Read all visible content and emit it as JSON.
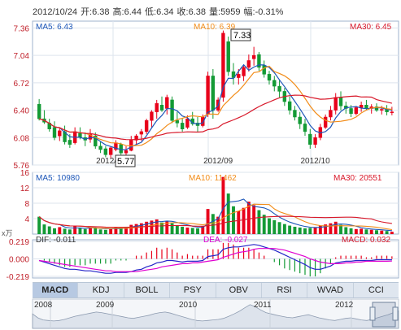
{
  "header": {
    "date": "2012/10/24",
    "open_label": "开:",
    "open": "6.38",
    "high_label": "高:",
    "high": "6.44",
    "low_label": "低:",
    "low": "6.34",
    "close_label": "收:",
    "close": "6.38",
    "volume_label": "量:",
    "volume": "5959",
    "change_label": "幅:",
    "change": "-0.31%"
  },
  "colors": {
    "up": "#e8001a",
    "down": "#139a35",
    "ma5": "#1d57b8",
    "ma10": "#f28c18",
    "ma30": "#d8182a",
    "grid": "#dde4ee",
    "axis_text": "#c0202a",
    "dea": "#e000d0",
    "dif": "#2424c8"
  },
  "chart_data": [
    {
      "type": "candlestick",
      "title": "",
      "legend": {
        "ma5": "MA5: 6.43",
        "ma10": "MA10: 6.39",
        "ma30": "MA30: 6.45"
      },
      "y_ticks": [
        "7.36",
        "7.04",
        "6.72",
        "6.40",
        "6.08",
        "5.76"
      ],
      "ylim": [
        5.76,
        7.44
      ],
      "x_labels": [
        "2012/08",
        "2012/09",
        "2012/10"
      ],
      "annotations": {
        "max": "7.33",
        "min": "5.77"
      },
      "ohlc": [
        [
          6.47,
          6.53,
          6.28,
          6.3
        ],
        [
          6.3,
          6.4,
          6.24,
          6.26
        ],
        [
          6.25,
          6.3,
          6.15,
          6.18
        ],
        [
          6.2,
          6.27,
          6.05,
          6.08
        ],
        [
          6.1,
          6.2,
          6.04,
          6.16
        ],
        [
          6.15,
          6.22,
          6.0,
          6.03
        ],
        [
          6.05,
          6.12,
          5.96,
          6.0
        ],
        [
          6.02,
          6.2,
          6.0,
          6.15
        ],
        [
          6.13,
          6.2,
          6.06,
          6.08
        ],
        [
          6.08,
          6.14,
          5.98,
          6.05
        ],
        [
          6.06,
          6.18,
          6.02,
          6.12
        ],
        [
          6.1,
          6.14,
          5.95,
          5.98
        ],
        [
          5.98,
          6.03,
          5.9,
          5.94
        ],
        [
          5.95,
          5.98,
          5.85,
          5.88
        ],
        [
          5.88,
          5.98,
          5.84,
          5.96
        ],
        [
          5.94,
          6.05,
          5.92,
          6.02
        ],
        [
          6.0,
          6.02,
          5.88,
          5.9
        ],
        [
          5.9,
          5.98,
          5.77,
          5.93
        ],
        [
          5.93,
          6.1,
          5.92,
          6.05
        ],
        [
          6.05,
          6.12,
          6.0,
          6.1
        ],
        [
          6.12,
          6.18,
          6.04,
          6.15
        ],
        [
          6.15,
          6.3,
          6.12,
          6.28
        ],
        [
          6.28,
          6.4,
          6.2,
          6.38
        ],
        [
          6.38,
          6.52,
          6.3,
          6.48
        ],
        [
          6.46,
          6.56,
          6.38,
          6.4
        ],
        [
          6.42,
          6.58,
          6.35,
          6.55
        ],
        [
          6.52,
          6.56,
          6.25,
          6.28
        ],
        [
          6.28,
          6.38,
          6.2,
          6.25
        ],
        [
          6.25,
          6.3,
          6.15,
          6.18
        ],
        [
          6.2,
          6.34,
          6.18,
          6.3
        ],
        [
          6.3,
          6.38,
          6.22,
          6.24
        ],
        [
          6.25,
          6.32,
          6.14,
          6.22
        ],
        [
          6.22,
          6.35,
          6.2,
          6.32
        ],
        [
          6.35,
          6.85,
          6.32,
          6.8
        ],
        [
          6.8,
          6.88,
          6.3,
          6.4
        ],
        [
          6.4,
          6.55,
          6.38,
          6.52
        ],
        [
          6.55,
          7.33,
          6.5,
          7.3
        ],
        [
          7.2,
          7.26,
          6.8,
          6.85
        ],
        [
          6.85,
          6.95,
          6.7,
          6.78
        ],
        [
          6.78,
          6.88,
          6.7,
          6.82
        ],
        [
          6.8,
          6.92,
          6.74,
          6.9
        ],
        [
          6.9,
          7.05,
          6.85,
          6.98
        ],
        [
          7.0,
          7.14,
          6.92,
          7.04
        ],
        [
          7.05,
          7.08,
          6.86,
          6.9
        ],
        [
          6.92,
          6.98,
          6.78,
          6.82
        ],
        [
          6.82,
          6.86,
          6.7,
          6.75
        ],
        [
          6.75,
          6.8,
          6.62,
          6.68
        ],
        [
          6.68,
          6.75,
          6.55,
          6.62
        ],
        [
          6.62,
          6.66,
          6.45,
          6.5
        ],
        [
          6.5,
          6.56,
          6.35,
          6.4
        ],
        [
          6.4,
          6.45,
          6.28,
          6.32
        ],
        [
          6.32,
          6.38,
          6.18,
          6.24
        ],
        [
          6.24,
          6.3,
          6.1,
          6.15
        ],
        [
          6.12,
          6.18,
          5.95,
          6.0
        ],
        [
          6.0,
          6.12,
          5.96,
          6.08
        ],
        [
          6.08,
          6.24,
          6.05,
          6.2
        ],
        [
          6.2,
          6.35,
          6.18,
          6.32
        ],
        [
          6.32,
          6.45,
          6.28,
          6.4
        ],
        [
          6.4,
          6.6,
          6.35,
          6.55
        ],
        [
          6.55,
          6.62,
          6.4,
          6.45
        ],
        [
          6.45,
          6.5,
          6.36,
          6.42
        ],
        [
          6.42,
          6.46,
          6.32,
          6.36
        ],
        [
          6.36,
          6.45,
          6.34,
          6.43
        ],
        [
          6.43,
          6.5,
          6.38,
          6.46
        ],
        [
          6.46,
          6.52,
          6.4,
          6.42
        ],
        [
          6.42,
          6.47,
          6.36,
          6.44
        ],
        [
          6.44,
          6.48,
          6.38,
          6.4
        ],
        [
          6.4,
          6.45,
          6.35,
          6.41
        ],
        [
          6.41,
          6.46,
          6.34,
          6.38
        ],
        [
          6.38,
          6.44,
          6.34,
          6.38
        ]
      ]
    },
    {
      "type": "bar",
      "title": "",
      "legend": {
        "ma5": "MA5: 10980",
        "ma10": "MA10: 11462",
        "ma30": "MA30: 20551"
      },
      "y_ticks": [
        "16",
        "12",
        "8",
        "4"
      ],
      "ylim": [
        0,
        16
      ],
      "unit": "x万",
      "values": [
        4.5,
        2.5,
        2.0,
        1.5,
        1.8,
        1.4,
        1.2,
        2.0,
        1.6,
        1.3,
        1.8,
        1.5,
        1.2,
        1.1,
        1.4,
        1.8,
        1.6,
        1.9,
        2.4,
        2.6,
        2.8,
        3.2,
        3.5,
        3.8,
        3.0,
        3.4,
        2.8,
        2.2,
        1.9,
        1.7,
        1.6,
        1.5,
        2.0,
        6.5,
        5.2,
        4.5,
        14.8,
        10.5,
        7.2,
        6.0,
        6.8,
        8.4,
        7.5,
        6.2,
        5.0,
        4.1,
        3.6,
        3.1,
        2.6,
        2.2,
        1.9,
        1.7,
        1.5,
        1.6,
        1.8,
        2.2,
        2.5,
        2.8,
        3.2,
        2.4,
        1.8,
        1.5,
        1.3,
        1.4,
        1.2,
        1.1,
        1.0,
        0.9,
        0.8,
        0.6
      ]
    },
    {
      "type": "bar",
      "title": "",
      "legend": {
        "dif": "DIF: -0.011",
        "dea": "DEA: -0.027",
        "macd": "MACD: 0.032"
      },
      "y_ticks": [
        "0.219",
        "0.000",
        "-0.219"
      ],
      "ylim": [
        -0.219,
        0.219
      ],
      "dif": [
        -0.02,
        -0.04,
        -0.06,
        -0.08,
        -0.1,
        -0.12,
        -0.13,
        -0.13,
        -0.14,
        -0.15,
        -0.15,
        -0.16,
        -0.17,
        -0.18,
        -0.18,
        -0.17,
        -0.17,
        -0.17,
        -0.16,
        -0.14,
        -0.13,
        -0.1,
        -0.08,
        -0.05,
        -0.04,
        -0.02,
        -0.02,
        -0.03,
        -0.04,
        -0.03,
        -0.03,
        -0.03,
        -0.02,
        0.03,
        0.04,
        0.05,
        0.12,
        0.14,
        0.15,
        0.15,
        0.16,
        0.17,
        0.18,
        0.17,
        0.15,
        0.13,
        0.11,
        0.08,
        0.05,
        0.02,
        -0.01,
        -0.04,
        -0.07,
        -0.11,
        -0.13,
        -0.13,
        -0.11,
        -0.09,
        -0.05,
        -0.04,
        -0.03,
        -0.03,
        -0.02,
        -0.02,
        -0.02,
        -0.02,
        -0.01,
        -0.01,
        -0.01,
        -0.011
      ],
      "dea": [
        -0.02,
        -0.03,
        -0.04,
        -0.05,
        -0.06,
        -0.07,
        -0.08,
        -0.09,
        -0.1,
        -0.11,
        -0.12,
        -0.13,
        -0.14,
        -0.15,
        -0.15,
        -0.16,
        -0.16,
        -0.16,
        -0.16,
        -0.16,
        -0.15,
        -0.14,
        -0.13,
        -0.12,
        -0.1,
        -0.09,
        -0.08,
        -0.07,
        -0.06,
        -0.06,
        -0.05,
        -0.05,
        -0.04,
        -0.03,
        -0.02,
        -0.01,
        0.02,
        0.04,
        0.06,
        0.08,
        0.09,
        0.1,
        0.12,
        0.13,
        0.13,
        0.13,
        0.13,
        0.12,
        0.11,
        0.09,
        0.07,
        0.05,
        0.03,
        0.0,
        -0.02,
        -0.04,
        -0.05,
        -0.06,
        -0.06,
        -0.06,
        -0.05,
        -0.05,
        -0.04,
        -0.04,
        -0.03,
        -0.03,
        -0.03,
        -0.03,
        -0.03,
        -0.027
      ]
    },
    {
      "type": "area",
      "title": "",
      "x_labels": [
        "2008",
        "2009",
        "2010",
        "2011",
        "2012"
      ],
      "values": [
        0.55,
        0.4,
        0.32,
        0.3,
        0.28,
        0.3,
        0.34,
        0.4,
        0.46,
        0.5,
        0.54,
        0.58,
        0.62,
        0.6,
        0.56,
        0.52,
        0.48,
        0.44,
        0.4,
        0.38,
        0.42,
        0.46,
        0.5,
        0.56,
        0.6,
        0.62,
        0.58,
        0.52,
        0.46,
        0.4,
        0.34,
        0.3,
        0.28,
        0.3,
        0.32,
        0.34,
        0.38,
        0.46,
        0.55,
        0.65,
        0.78,
        0.9,
        0.82,
        0.7,
        0.6,
        0.55,
        0.5,
        0.46,
        0.42,
        0.4,
        0.44,
        0.48,
        0.52,
        0.46,
        0.4,
        0.36,
        0.32,
        0.3,
        0.34,
        0.38,
        0.4,
        0.36,
        0.32,
        0.3,
        0.34,
        0.4,
        0.46,
        0.52,
        0.6,
        0.66
      ]
    }
  ],
  "indicator_tabs": [
    "MACD",
    "KDJ",
    "BOLL",
    "PSY",
    "OBV",
    "RSI",
    "WVAD",
    "CCI"
  ],
  "active_tab": "MACD"
}
